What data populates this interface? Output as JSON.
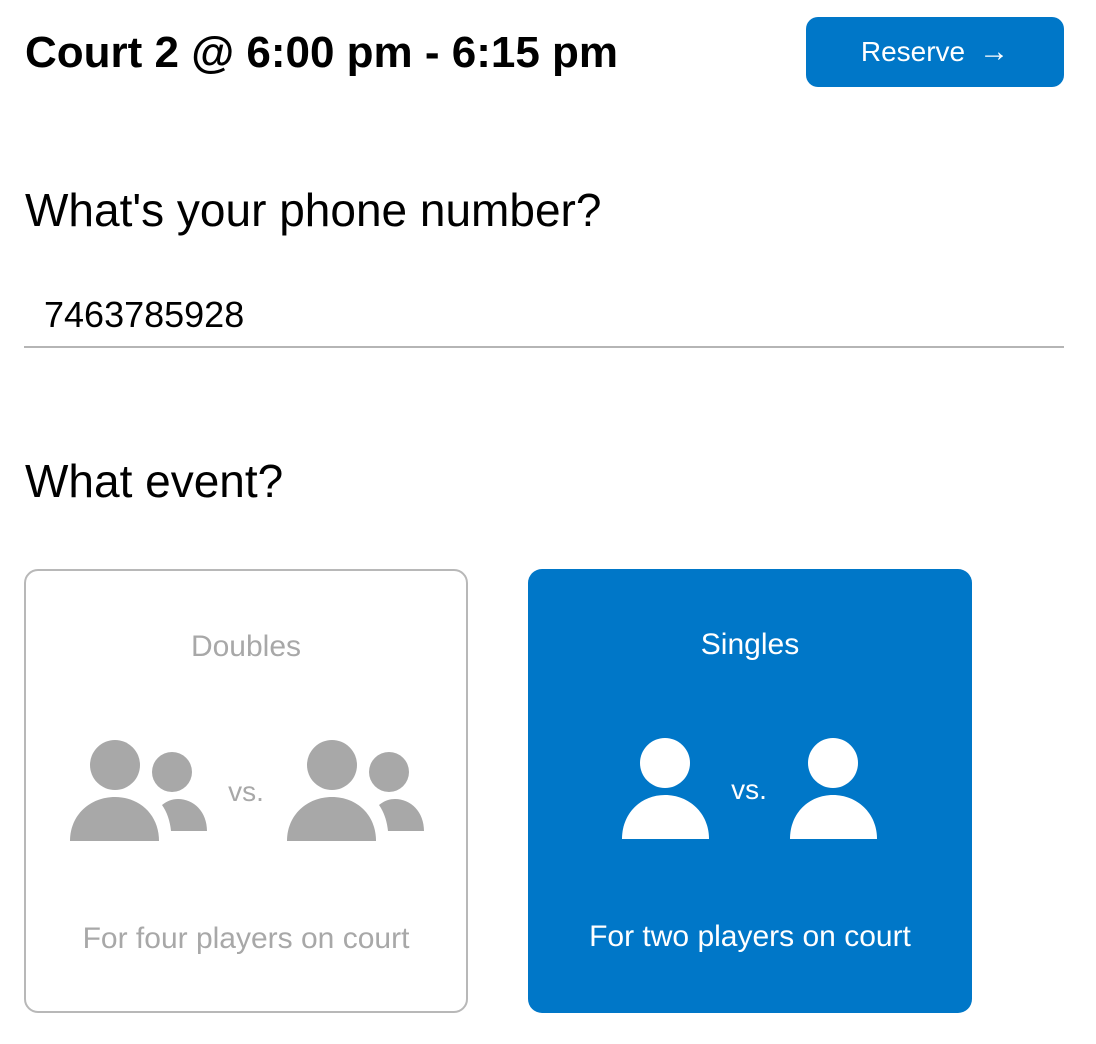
{
  "header": {
    "title": "Court 2 @ 6:00 pm - 6:15 pm",
    "reserve_label": "Reserve",
    "reserve_arrow": "→"
  },
  "phone": {
    "question": "What's your phone number?",
    "value": "7463785928"
  },
  "event": {
    "question": "What event?",
    "options": [
      {
        "title": "Doubles",
        "vs": "vs.",
        "description": "For four players on court",
        "selected": false,
        "icon": "two-players-icon"
      },
      {
        "title": "Singles",
        "vs": "vs.",
        "description": "For two players on court",
        "selected": true,
        "icon": "single-player-icon"
      }
    ]
  },
  "colors": {
    "accent": "#0077c8",
    "inactive_text": "#a8a8a8",
    "inactive_icon": "#a8a8a8",
    "inactive_border": "#b8b8b8"
  }
}
